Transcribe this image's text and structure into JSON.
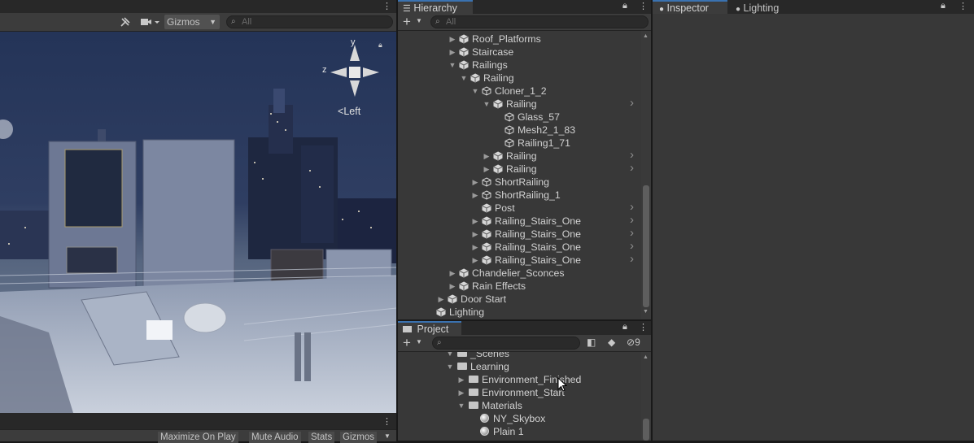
{
  "scene": {
    "gizmos_label": "Gizmos",
    "search_placeholder": "All",
    "orientation_left_label": "Left",
    "axis_y": "y",
    "axis_z": "z"
  },
  "game_bar": {
    "maximize_label": "Maximize On Play",
    "mute_label": "Mute Audio",
    "stats_label": "Stats",
    "gizmos_label": "Gizmos"
  },
  "hierarchy": {
    "tab_label": "Hierarchy",
    "search_placeholder": "All",
    "items": [
      {
        "label": "Roof_Platforms",
        "depth": 2,
        "expanded": false,
        "arrow": true,
        "chev": false
      },
      {
        "label": "Staircase",
        "depth": 2,
        "expanded": false,
        "arrow": true,
        "chev": false
      },
      {
        "label": "Railings",
        "depth": 2,
        "expanded": true,
        "arrow": true,
        "chev": false
      },
      {
        "label": "Railing",
        "depth": 3,
        "expanded": true,
        "arrow": true,
        "chev": false
      },
      {
        "label": "Cloner_1_2",
        "depth": 4,
        "expanded": true,
        "arrow": true,
        "chev": false
      },
      {
        "label": "Railing",
        "depth": 5,
        "expanded": true,
        "arrow": true,
        "chev": true
      },
      {
        "label": "Glass_57",
        "depth": 6,
        "expanded": false,
        "arrow": false,
        "chev": false
      },
      {
        "label": "Mesh2_1_83",
        "depth": 6,
        "expanded": false,
        "arrow": false,
        "chev": false
      },
      {
        "label": "Railing1_71",
        "depth": 6,
        "expanded": false,
        "arrow": false,
        "chev": false
      },
      {
        "label": "Railing",
        "depth": 5,
        "expanded": false,
        "arrow": true,
        "chev": true
      },
      {
        "label": "Railing",
        "depth": 5,
        "expanded": false,
        "arrow": true,
        "chev": true
      },
      {
        "label": "ShortRailing",
        "depth": 4,
        "expanded": false,
        "arrow": true,
        "chev": false
      },
      {
        "label": "ShortRailing_1",
        "depth": 4,
        "expanded": false,
        "arrow": true,
        "chev": false
      },
      {
        "label": "Post",
        "depth": 4,
        "expanded": false,
        "arrow": false,
        "chev": true
      },
      {
        "label": "Railing_Stairs_One",
        "depth": 4,
        "expanded": false,
        "arrow": true,
        "chev": true
      },
      {
        "label": "Railing_Stairs_One",
        "depth": 4,
        "expanded": false,
        "arrow": true,
        "chev": true
      },
      {
        "label": "Railing_Stairs_One",
        "depth": 4,
        "expanded": false,
        "arrow": true,
        "chev": true
      },
      {
        "label": "Railing_Stairs_One",
        "depth": 4,
        "expanded": false,
        "arrow": true,
        "chev": true
      },
      {
        "label": "Chandelier_Sconces",
        "depth": 2,
        "expanded": false,
        "arrow": true,
        "chev": false
      },
      {
        "label": "Rain Effects",
        "depth": 2,
        "expanded": false,
        "arrow": true,
        "chev": false
      },
      {
        "label": "Door Start",
        "depth": 1,
        "expanded": false,
        "arrow": true,
        "chev": false
      },
      {
        "label": "Lighting",
        "depth": 0,
        "expanded": false,
        "arrow": false,
        "chev": false
      }
    ]
  },
  "project": {
    "tab_label": "Project",
    "hidden_count": "9",
    "items": [
      {
        "label": "_Scenes",
        "depth": 0,
        "expanded": true,
        "kind": "folder"
      },
      {
        "label": "Learning",
        "depth": 0,
        "expanded": true,
        "kind": "folder"
      },
      {
        "label": "Environment_Finished",
        "depth": 1,
        "expanded": false,
        "kind": "folder"
      },
      {
        "label": "Environment_Start",
        "depth": 1,
        "expanded": false,
        "kind": "folder"
      },
      {
        "label": "Materials",
        "depth": 1,
        "expanded": true,
        "kind": "folder"
      },
      {
        "label": "NY_Skybox",
        "depth": 2,
        "expanded": false,
        "kind": "material"
      },
      {
        "label": "Plain 1",
        "depth": 2,
        "expanded": false,
        "kind": "material"
      }
    ]
  },
  "inspector": {
    "inspector_tab": "Inspector",
    "lighting_tab": "Lighting"
  },
  "colors": {
    "accent": "#3a72b0",
    "panel": "#383838",
    "toolbar": "#3c3c3c",
    "text": "#d2d2d2"
  }
}
